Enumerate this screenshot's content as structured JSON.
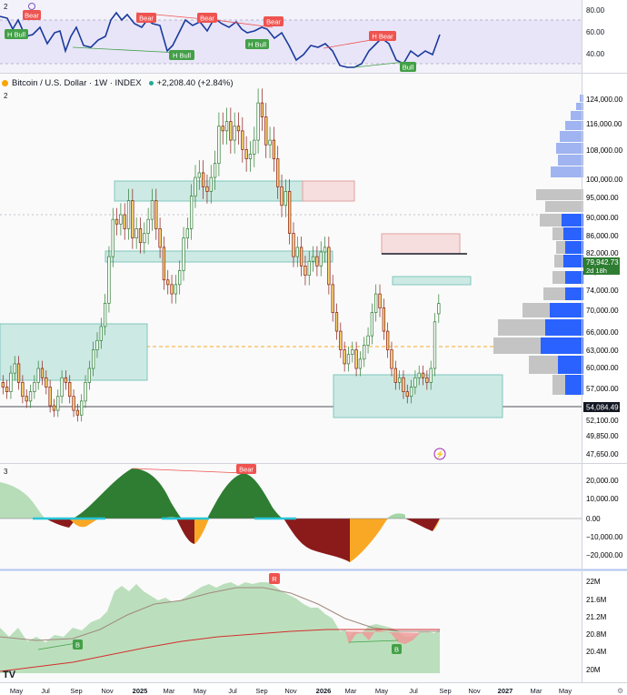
{
  "colors": {
    "up": "#2e7d32",
    "down": "#8b1a1a",
    "bull": "#43a047",
    "bear": "#ef5350",
    "line": "#1a3a9c",
    "teal": "#7fc8bd",
    "pink": "#f5c7c7",
    "orange": "#f9a825",
    "vp_blue": "#2962ff",
    "vp_grey": "#9e9e9e"
  },
  "panes": {
    "rsi": {
      "index": "2",
      "ticks": [
        "80.00",
        "60.00",
        "40.00"
      ],
      "labels": {
        "bear1": "Bear",
        "bear2": "Bear",
        "bear3": "Bear",
        "bear4": "Bear",
        "hbull1": "H Bull",
        "hbull2": "H Bull",
        "hbull3": "H Bull",
        "hbear": "H Bear",
        "bull": "Bull"
      }
    },
    "price": {
      "symbol": "Bitcoin / U.S. Dollar · 1W · INDEX",
      "change": "+2,208.40 (+2.84%)",
      "index": "2",
      "current_price": "79,942.73",
      "countdown": "2d 18h",
      "line_level": "54,084.49",
      "ticks": [
        "124,000.00",
        "116,000.00",
        "108,000.00",
        "100,000.00",
        "95,000.00",
        "90,000.00",
        "86,000.00",
        "82,000.00",
        "78,000.00",
        "74,000.00",
        "70,000.00",
        "66,000.00",
        "63,000.00",
        "60,000.00",
        "57,000.00",
        "52,100.00",
        "49,850.00",
        "47,650.00"
      ]
    },
    "osc": {
      "index": "3",
      "ticks": [
        "20,000.00",
        "10,000.00",
        "0.00",
        "−10,000.00",
        "−20,000.00"
      ],
      "bear_label": "Bear"
    },
    "bottom": {
      "ticks": [
        "22M",
        "21.6M",
        "21.2M",
        "20.8M",
        "20.4M",
        "20M"
      ],
      "labels": {
        "r": "R",
        "b1": "B",
        "b2": "B"
      }
    }
  },
  "x_axis": {
    "labels": [
      "May",
      "Jul",
      "Sep",
      "Nov",
      "2025",
      "Mar",
      "May",
      "Jul",
      "Sep",
      "Nov",
      "2026",
      "Mar",
      "May",
      "Jul",
      "Sep",
      "Nov",
      "2027",
      "Mar",
      "May"
    ]
  },
  "watermark": "TV",
  "chart_data": {
    "type": "candlestick",
    "title": "Bitcoin / U.S. Dollar · 1W · INDEX",
    "x_labels": [
      "May",
      "Jul",
      "Sep",
      "Nov",
      "2025",
      "Mar",
      "May",
      "Jul",
      "Sep",
      "Nov",
      "2026",
      "Mar",
      "May",
      "Jul",
      "Sep"
    ],
    "ylim": [
      47650,
      126000
    ],
    "close": [
      62000,
      61000,
      65000,
      67000,
      63000,
      60000,
      59000,
      61000,
      63000,
      66000,
      64000,
      62000,
      58000,
      57000,
      60000,
      64000,
      63000,
      60000,
      57000,
      56000,
      59000,
      63000,
      66000,
      70000,
      72000,
      75000,
      80000,
      90000,
      98000,
      97000,
      99000,
      96000,
      102000,
      94000,
      96000,
      93000,
      95000,
      98000,
      102000,
      96000,
      92000,
      85000,
      84000,
      82000,
      84000,
      87000,
      94000,
      96000,
      103000,
      107000,
      108000,
      105000,
      104000,
      107000,
      110000,
      118000,
      117000,
      119000,
      115000,
      118000,
      117000,
      113000,
      111000,
      112000,
      115000,
      123000,
      120000,
      114000,
      115000,
      111000,
      105000,
      101000,
      104000,
      95000,
      90000,
      92000,
      88000,
      86000,
      89000,
      90000,
      88000,
      91000,
      92000,
      84000,
      78000,
      74000,
      70000,
      67000,
      69000,
      70000,
      66000,
      68000,
      71000,
      73000,
      78000,
      82000,
      79000,
      74000,
      70000,
      66000,
      63000,
      64000,
      61000,
      60000,
      62000,
      64000,
      65000,
      64000,
      63000,
      66000,
      76000,
      79943
    ],
    "open": [
      63000,
      62000,
      61000,
      65000,
      67000,
      63000,
      60000,
      59000,
      61000,
      63000,
      66000,
      64000,
      62000,
      58000,
      57000,
      60000,
      64000,
      63000,
      60000,
      57000,
      56000,
      59000,
      63000,
      66000,
      70000,
      72000,
      75000,
      80000,
      90000,
      98000,
      97000,
      99000,
      96000,
      102000,
      94000,
      96000,
      93000,
      95000,
      98000,
      102000,
      96000,
      92000,
      85000,
      84000,
      82000,
      84000,
      87000,
      94000,
      96000,
      103000,
      107000,
      108000,
      105000,
      104000,
      107000,
      110000,
      118000,
      117000,
      119000,
      115000,
      118000,
      117000,
      113000,
      111000,
      112000,
      115000,
      123000,
      120000,
      114000,
      115000,
      111000,
      105000,
      101000,
      104000,
      95000,
      90000,
      92000,
      88000,
      86000,
      89000,
      90000,
      88000,
      91000,
      92000,
      84000,
      78000,
      74000,
      70000,
      67000,
      69000,
      70000,
      66000,
      68000,
      71000,
      73000,
      78000,
      82000,
      79000,
      74000,
      70000,
      66000,
      63000,
      64000,
      61000,
      60000,
      62000,
      64000,
      65000,
      64000,
      63000,
      66000,
      77734
    ],
    "annotations": {
      "current_price": 79942.73,
      "horizontal_line": 54084.49,
      "change": "+2,208.40 (+2.84%)"
    }
  }
}
